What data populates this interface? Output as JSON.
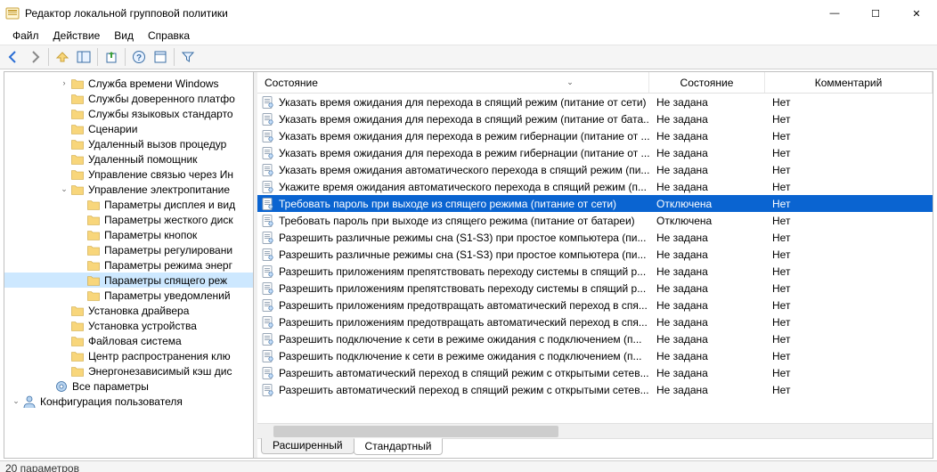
{
  "window": {
    "title": "Редактор локальной групповой политики",
    "minimize": "—",
    "maximize": "☐",
    "close": "✕"
  },
  "menu": {
    "file": "Файл",
    "action": "Действие",
    "view": "Вид",
    "help": "Справка"
  },
  "tree": {
    "items": [
      {
        "indent": 3,
        "expander": "›",
        "icon": "folder",
        "label": "Служба времени Windows"
      },
      {
        "indent": 3,
        "expander": "",
        "icon": "folder",
        "label": "Службы доверенного платфо"
      },
      {
        "indent": 3,
        "expander": "",
        "icon": "folder",
        "label": "Службы языковых стандарто"
      },
      {
        "indent": 3,
        "expander": "",
        "icon": "folder",
        "label": "Сценарии"
      },
      {
        "indent": 3,
        "expander": "",
        "icon": "folder",
        "label": "Удаленный вызов процедур"
      },
      {
        "indent": 3,
        "expander": "",
        "icon": "folder",
        "label": "Удаленный помощник"
      },
      {
        "indent": 3,
        "expander": "",
        "icon": "folder",
        "label": "Управление связью через Ин"
      },
      {
        "indent": 3,
        "expander": "⌄",
        "icon": "folder",
        "label": "Управление электропитание"
      },
      {
        "indent": 4,
        "expander": "",
        "icon": "folder",
        "label": "Параметры дисплея и вид"
      },
      {
        "indent": 4,
        "expander": "",
        "icon": "folder",
        "label": "Параметры жесткого диск"
      },
      {
        "indent": 4,
        "expander": "",
        "icon": "folder",
        "label": "Параметры кнопок"
      },
      {
        "indent": 4,
        "expander": "",
        "icon": "folder",
        "label": "Параметры регулировани"
      },
      {
        "indent": 4,
        "expander": "",
        "icon": "folder",
        "label": "Параметры режима энерг"
      },
      {
        "indent": 4,
        "expander": "",
        "icon": "folder",
        "label": "Параметры спящего реж",
        "selected": true
      },
      {
        "indent": 4,
        "expander": "",
        "icon": "folder",
        "label": "Параметры уведомлений"
      },
      {
        "indent": 3,
        "expander": "",
        "icon": "folder",
        "label": "Установка драйвера"
      },
      {
        "indent": 3,
        "expander": "",
        "icon": "folder",
        "label": "Установка устройства"
      },
      {
        "indent": 3,
        "expander": "",
        "icon": "folder",
        "label": "Файловая система"
      },
      {
        "indent": 3,
        "expander": "",
        "icon": "folder",
        "label": "Центр распространения клю"
      },
      {
        "indent": 3,
        "expander": "",
        "icon": "folder",
        "label": "Энергонезависимый кэш дис"
      },
      {
        "indent": 2,
        "expander": "",
        "icon": "gear",
        "label": "Все параметры"
      },
      {
        "indent": 0,
        "expander": "⌄",
        "icon": "user",
        "label": "Конфигурация пользователя"
      }
    ]
  },
  "list": {
    "header": {
      "name": "Состояние",
      "state": "Состояние",
      "comment": "Комментарий"
    },
    "rows": [
      {
        "name": "Указать время ожидания для перехода в спящий режим (питание от сети)",
        "state": "Не задана",
        "comment": "Нет"
      },
      {
        "name": "Указать время ожидания для перехода в спящий режим (питание от бата...",
        "state": "Не задана",
        "comment": "Нет"
      },
      {
        "name": "Указать время ожидания для перехода в режим гибернации (питание от ...",
        "state": "Не задана",
        "comment": "Нет"
      },
      {
        "name": "Указать время ожидания для перехода в режим гибернации (питание от ...",
        "state": "Не задана",
        "comment": "Нет"
      },
      {
        "name": "Указать время ожидания автоматического перехода в спящий режим (пи...",
        "state": "Не задана",
        "comment": "Нет"
      },
      {
        "name": "Укажите время ожидания автоматического перехода в спящий режим (п...",
        "state": "Не задана",
        "comment": "Нет"
      },
      {
        "name": "Требовать пароль при выходе из спящего режима (питание от сети)",
        "state": "Отключена",
        "comment": "Нет",
        "selected": true
      },
      {
        "name": "Требовать пароль при выходе из спящего режима (питание от батареи)",
        "state": "Отключена",
        "comment": "Нет"
      },
      {
        "name": "Разрешить различные режимы сна (S1-S3) при простое компьютера (пи...",
        "state": "Не задана",
        "comment": "Нет"
      },
      {
        "name": "Разрешить различные режимы сна (S1-S3) при простое компьютера (пи...",
        "state": "Не задана",
        "comment": "Нет"
      },
      {
        "name": "Разрешить приложениям препятствовать переходу системы в спящий р...",
        "state": "Не задана",
        "comment": "Нет"
      },
      {
        "name": "Разрешить приложениям препятствовать переходу системы в спящий р...",
        "state": "Не задана",
        "comment": "Нет"
      },
      {
        "name": "Разрешить приложениям предотвращать автоматический переход в спя...",
        "state": "Не задана",
        "comment": "Нет"
      },
      {
        "name": "Разрешить приложениям предотвращать автоматический переход в спя...",
        "state": "Не задана",
        "comment": "Нет"
      },
      {
        "name": "Разрешить подключение к сети в режиме ожидания с подключением (п...",
        "state": "Не задана",
        "comment": "Нет"
      },
      {
        "name": "Разрешить подключение к сети в режиме ожидания с подключением (п...",
        "state": "Не задана",
        "comment": "Нет"
      },
      {
        "name": "Разрешить автоматический переход в спящий режим с открытыми сетев...",
        "state": "Не задана",
        "comment": "Нет"
      },
      {
        "name": "Разрешить автоматический переход в спящий режим с открытыми сетев...",
        "state": "Не задана",
        "comment": "Нет"
      }
    ]
  },
  "tabs": {
    "extended": "Расширенный",
    "standard": "Стандартный"
  },
  "status": "20 параметров"
}
